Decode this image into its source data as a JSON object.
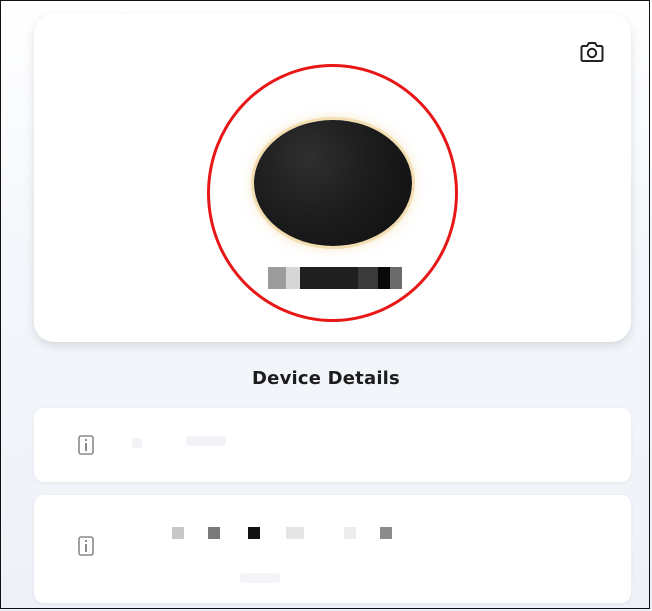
{
  "profile": {
    "camera_icon": "camera-icon",
    "avatar_state": "blurred-profile-photo",
    "name_redacted": true
  },
  "details": {
    "title": "Device Details",
    "rows": [
      {
        "icon": "device-info-icon",
        "value": ""
      },
      {
        "icon": "device-info-icon",
        "value": ""
      }
    ]
  },
  "colors": {
    "highlight_ring": "#e81717",
    "card_bg": "#ffffff",
    "page_bg": "#eef2f8"
  }
}
